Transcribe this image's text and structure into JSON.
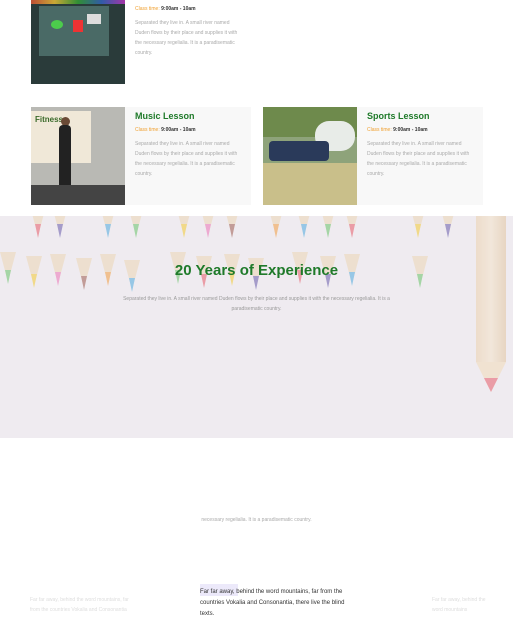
{
  "classes": [
    {
      "id": "top",
      "title": "",
      "time_label": "Class time:",
      "time_value": "9:00am - 10am",
      "description": "Separated they live in. A small river named Duden flows by their place and supplies it with the necessary regelialia. It is a paradisematic country."
    },
    {
      "id": "music",
      "title": "Music Lesson",
      "time_label": "Class time:",
      "time_value": "9:00am - 10am",
      "description": "Separated they live in. A small river named Duden flows by their place and supplies it with the necessary regelialia. It is a paradisematic country."
    },
    {
      "id": "sports",
      "title": "Sports Lesson",
      "time_label": "Class time:",
      "time_value": "9:00am - 10am",
      "description": "Separated they live in. A small river named Duden flows by their place and supplies it with the necessary regelialia. It is a paradisematic country."
    }
  ],
  "music_banner_text": "Fitness",
  "experience": {
    "title": "20 Years of Experience",
    "text": "Separated they live in. A small river named Duden flows by their place and supplies it with the necessary regelialia. It is a paradisematic country."
  },
  "lower": {
    "text": "necessary regelialia. It is a paradisematic country.",
    "testimonial": "Far far away, behind the word mountains, far from the countries Vokalia and Consonantia, there live the blind texts.",
    "side_left": "Far far away, behind the word mountains, far from the countries Vokalia and Consonantia",
    "side_right": "Far far away, behind the word mountains"
  },
  "colors": {
    "accent_green": "#1f7a2a",
    "accent_orange": "#f0a030"
  }
}
